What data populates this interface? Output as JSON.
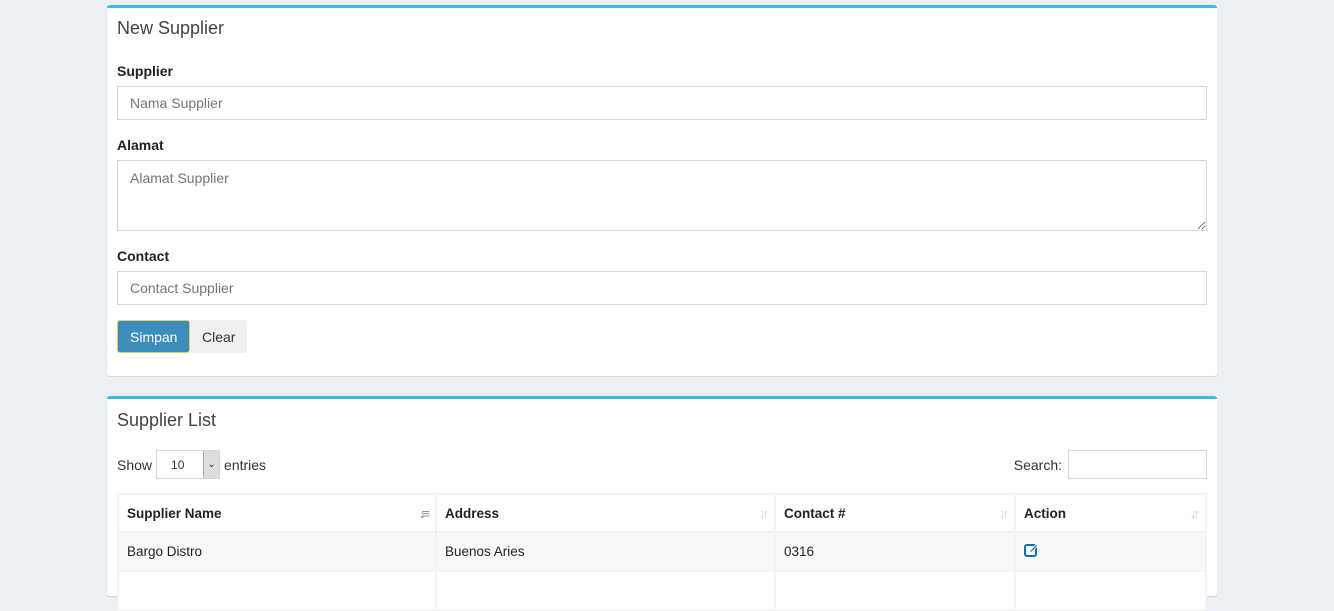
{
  "form": {
    "title": "New Supplier",
    "supplier_label": "Supplier",
    "supplier_placeholder": "Nama Supplier",
    "alamat_label": "Alamat",
    "alamat_placeholder": "Alamat Supplier",
    "contact_label": "Contact",
    "contact_placeholder": "Contact Supplier",
    "save_label": "Simpan",
    "clear_label": "Clear"
  },
  "list": {
    "title": "Supplier List",
    "show_label": "Show",
    "entries_value": "10",
    "entries_label": "entries",
    "search_label": "Search:",
    "columns": [
      "Supplier Name",
      "Address",
      "Contact #",
      "Action"
    ],
    "rows": [
      {
        "name": "Bargo Distro",
        "address": "Buenos Aries",
        "contact": "0316",
        "action_icon": "edit-icon"
      }
    ]
  },
  "colors": {
    "accent": "#3bb9e6",
    "primary_button": "#3c8dbc",
    "edit_icon": "#0073b7"
  }
}
